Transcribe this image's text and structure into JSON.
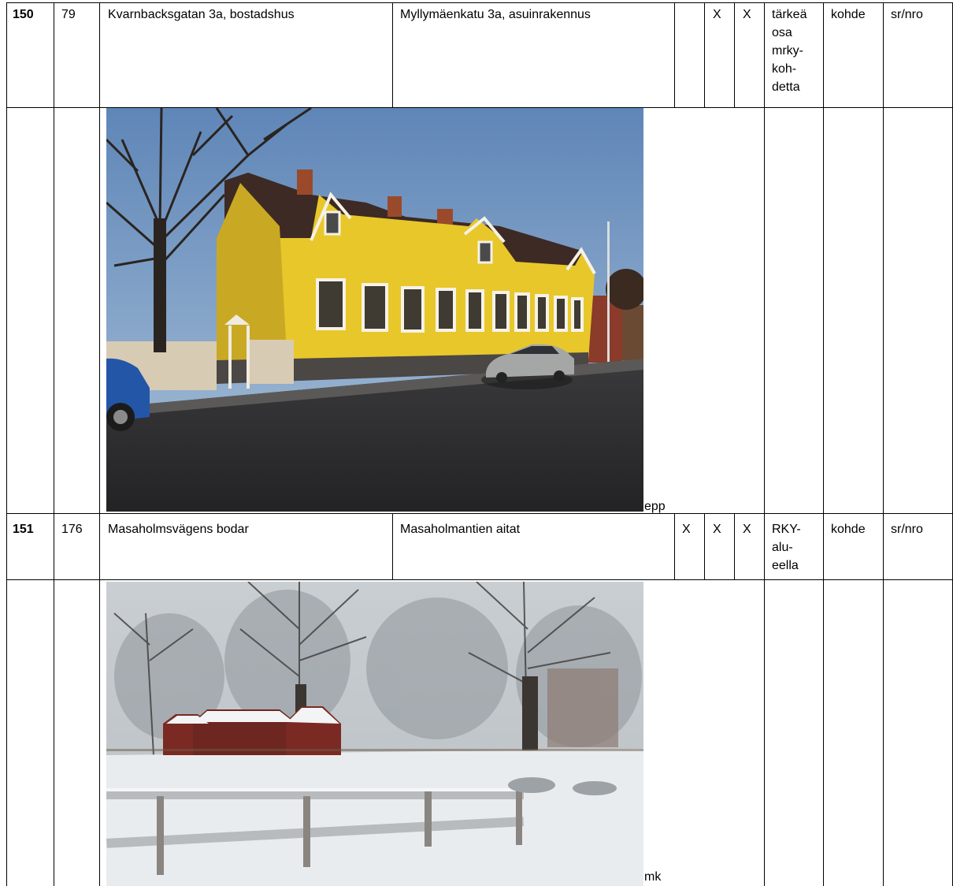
{
  "rows": [
    {
      "num": "150",
      "code": "79",
      "name_sv": "Kvarnbacksgatan 3a, bostadshus",
      "name_fi": "Myllymäenkatu 3a, asuinrakennus",
      "mark1": "",
      "mark2": "X",
      "mark3": "X",
      "note_lines": [
        "tärkeä",
        "osa",
        "mrky-",
        "koh-",
        "detta"
      ],
      "type": "kohde",
      "ref": "sr/nro",
      "photo_credit": "epp",
      "photo_icon": "yellow-house-photo"
    },
    {
      "num": "151",
      "code": "176",
      "name_sv": "Masaholmsvägens bodar",
      "name_fi": "Masaholmantien aitat",
      "mark1": "X",
      "mark2": "X",
      "mark3": "X",
      "note_lines": [
        "RKY-",
        "alu-",
        "eella"
      ],
      "type": "kohde",
      "ref": "sr/nro",
      "photo_credit": "mk",
      "photo_icon": "snowy-sheds-photo"
    }
  ],
  "colors": {
    "house_yellow": "#e8c72a",
    "sky_blue": "#7fa2c8",
    "snow": "#e9ecef",
    "shed_red": "#7a2a22",
    "car_blue": "#2456a8"
  }
}
